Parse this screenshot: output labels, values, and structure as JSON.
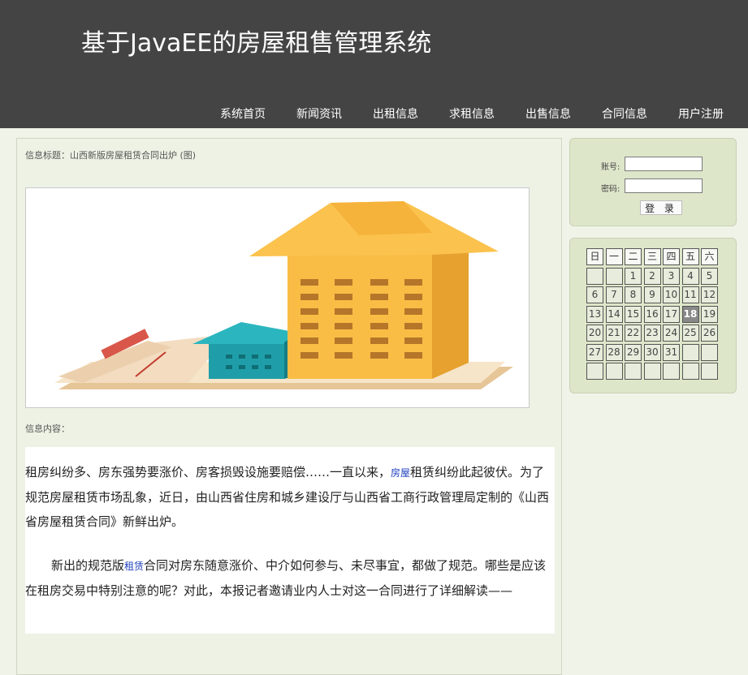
{
  "header": {
    "site_title": "基于JavaEE的房屋租售管理系统",
    "nav": [
      "系统首页",
      "新闻资讯",
      "出租信息",
      "求租信息",
      "出售信息",
      "合同信息",
      "用户注册"
    ]
  },
  "main": {
    "title_label": "信息标题：山西新版房屋租赁合同出炉 (图)",
    "content_label": "信息内容：",
    "paragraph1_before": "租房纠纷多、房东强势要涨价、房客损毁设施要赔偿……一直以来，",
    "paragraph1_keyword": "房屋",
    "paragraph1_after": "租赁纠纷此起彼伏。为了规范房屋租赁市场乱象，近日，由山西省住房和城乡建设厅与山西省工商行政管理局定制的《山西省房屋租赁合同》新鲜出炉。",
    "paragraph2_before": "新出的规范版",
    "paragraph2_keyword": "租赁",
    "paragraph2_after": "合同对房东随意涨价、中介如何参与、未尽事宜，都做了规范。哪些是应该在租房交易中特别注意的呢？对此，本报记者邀请业内人士对这一合同进行了详细解读——"
  },
  "login": {
    "account_label": "账号:",
    "password_label": "密码:",
    "account_value": "",
    "password_value": "",
    "login_button": "登 录"
  },
  "calendar": {
    "weekdays": [
      "日",
      "一",
      "二",
      "三",
      "四",
      "五",
      "六"
    ],
    "days": [
      "",
      "",
      "1",
      "2",
      "3",
      "4",
      "5",
      "6",
      "7",
      "8",
      "9",
      "10",
      "11",
      "12",
      "13",
      "14",
      "15",
      "16",
      "17",
      "18",
      "19",
      "20",
      "21",
      "22",
      "23",
      "24",
      "25",
      "26",
      "27",
      "28",
      "29",
      "30",
      "31",
      "",
      "",
      "",
      "",
      "",
      "",
      "",
      "",
      ""
    ],
    "today": "18"
  },
  "colors": {
    "header_bg": "#444444",
    "page_bg": "#f0f3e7",
    "sidebar_box": "#dde6c9",
    "house_yellow": "#f9bd45",
    "house_teal": "#1e9fab"
  }
}
